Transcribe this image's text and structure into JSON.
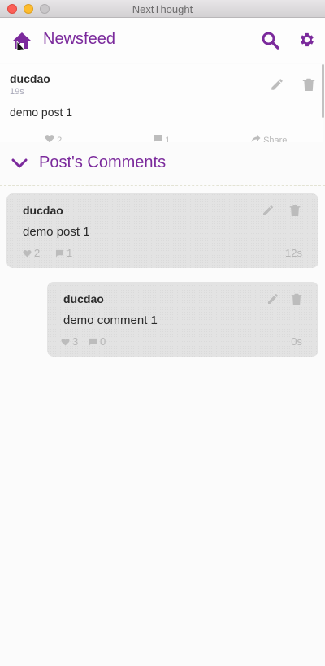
{
  "window": {
    "title": "NextThought"
  },
  "header": {
    "title": "Newsfeed",
    "home_icon": "home-icon",
    "search_icon": "search-icon",
    "settings_icon": "gear-icon",
    "accent": "#7b2a9c"
  },
  "post": {
    "author": "ducdao",
    "time": "19s",
    "body": "demo post 1",
    "likes": "2",
    "comments": "1",
    "share_label": "Share"
  },
  "comments_section": {
    "title": "Post's Comments",
    "toggle_icon": "chevron-down-icon"
  },
  "thread": {
    "original": {
      "author": "ducdao",
      "text": "demo post 1",
      "likes": "2",
      "comments": "1",
      "time": "12s"
    },
    "comments": [
      {
        "author": "ducdao",
        "text": "demo comment 1",
        "likes": "3",
        "comments": "0",
        "time": "0s"
      }
    ]
  }
}
